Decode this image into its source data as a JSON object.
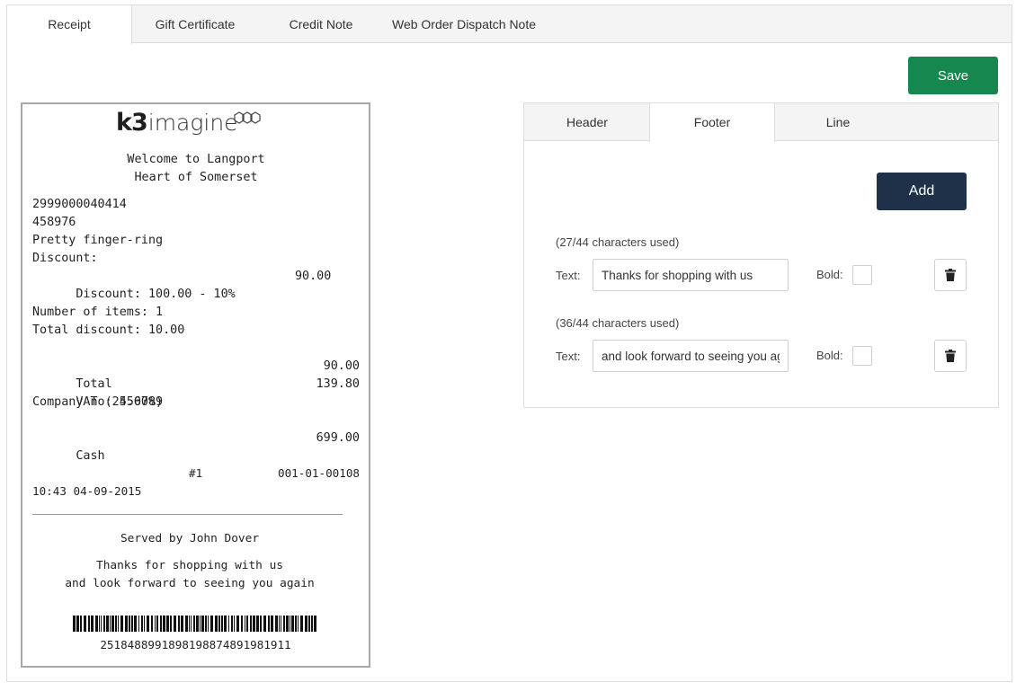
{
  "top_tabs": [
    {
      "label": "Receipt",
      "active": true
    },
    {
      "label": "Gift Certificate",
      "active": false
    },
    {
      "label": "Credit Note",
      "active": false
    },
    {
      "label": "Web Order Dispatch Note",
      "active": false
    }
  ],
  "toolbar": {
    "save_label": "Save"
  },
  "receipt": {
    "logo": {
      "k3": "k3",
      "imagine": "imagine"
    },
    "header_lines": [
      "Welcome to Langport",
      "Heart of Somerset"
    ],
    "item": {
      "barcode": "2999000040414",
      "code": "458976",
      "name": "Pretty finger-ring",
      "discount_label": "Discount:",
      "discount_line": "Discount: 100.00 - 10%",
      "discount_amount": "90.00"
    },
    "summary": {
      "items_count": "Number of items: 1",
      "total_discount": "Total discount: 10.00"
    },
    "totals": {
      "total_label": "Total",
      "total_value": "90.00",
      "vat_label": "VAT (25.00%)",
      "vat_value": "139.80",
      "company": "Company no: 456789"
    },
    "payment": {
      "label": "Cash",
      "value": "699.00"
    },
    "meta": {
      "date": "04-09-2015",
      "till": "#1",
      "ref": "001-01-00108",
      "time": "10:43"
    },
    "served_by": "Served by John Dover",
    "footer_lines": [
      "Thanks for shopping with us",
      "and look forward to seeing you again"
    ],
    "barcode_number": "2518488991898198874891981911"
  },
  "editor": {
    "sub_tabs": [
      {
        "label": "Header",
        "active": false
      },
      {
        "label": "Footer",
        "active": true
      },
      {
        "label": "Line",
        "active": false
      }
    ],
    "add_label": "Add",
    "text_label": "Text:",
    "bold_label": "Bold:",
    "footer_rows": [
      {
        "chars_used": "(27/44 characters used)",
        "text": "Thanks for shopping with us",
        "bold": false
      },
      {
        "chars_used": "(36/44 characters used)",
        "text": "and look forward to seeing you again",
        "bold": false
      }
    ]
  },
  "icons": {
    "delete": "trash-icon",
    "logo_mark": "hexagon-rings-icon"
  },
  "colors": {
    "save": "#16874f",
    "add": "#1e3149",
    "border": "#dcdcdc"
  }
}
